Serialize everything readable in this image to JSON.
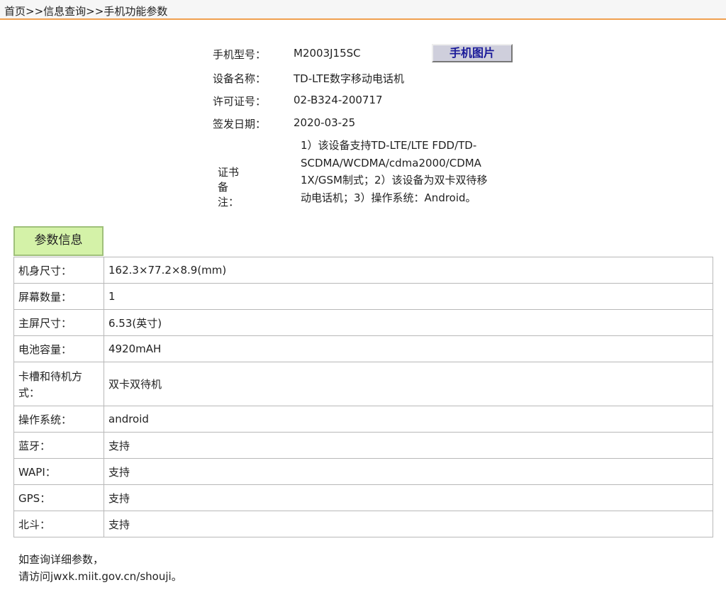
{
  "breadcrumb": {
    "home": "首页",
    "sep1": ">>",
    "query": "信息查询",
    "sep2": ">>",
    "current": "手机功能参数"
  },
  "device": {
    "model_label": "手机型号：",
    "model_value": "M2003J15SC",
    "name_label": "设备名称：",
    "name_value": "TD-LTE数字移动电话机",
    "license_label": "许可证号：",
    "license_value": "02-B324-200717",
    "date_label": "签发日期：",
    "date_value": "2020-03-25",
    "remark_label": "证书备注：",
    "remark_lines": [
      "1）该设备支持TD-LTE/LTE FDD/TD-",
      "SCDMA/WCDMA/cdma2000/CDMA",
      "1X/GSM制式；2）该设备为双卡双待移",
      "动电话机；3）操作系统：Android。"
    ]
  },
  "photo_button": "手机图片",
  "tab_label": "参数信息",
  "params": [
    {
      "key_lines": [
        "机身尺寸："
      ],
      "value": "162.3×77.2×8.9(mm)"
    },
    {
      "key_lines": [
        "屏幕数量："
      ],
      "value": "1"
    },
    {
      "key_lines": [
        "主屏尺寸："
      ],
      "value": "6.53(英寸)"
    },
    {
      "key_lines": [
        "电池容量："
      ],
      "value": "4920mAH"
    },
    {
      "key_lines": [
        "卡槽和待机方",
        "式："
      ],
      "value": "双卡双待机"
    },
    {
      "key_lines": [
        "操作系统："
      ],
      "value": "android"
    },
    {
      "key_lines": [
        "蓝牙："
      ],
      "value": "支持"
    },
    {
      "key_lines": [
        "WAPI："
      ],
      "value": "支持"
    },
    {
      "key_lines": [
        "GPS："
      ],
      "value": "支持"
    },
    {
      "key_lines": [
        "北斗："
      ],
      "value": "支持"
    }
  ],
  "footer": {
    "line1": "如查询详细参数，",
    "line2": "请访问jwxk.miit.gov.cn/shouji。"
  }
}
